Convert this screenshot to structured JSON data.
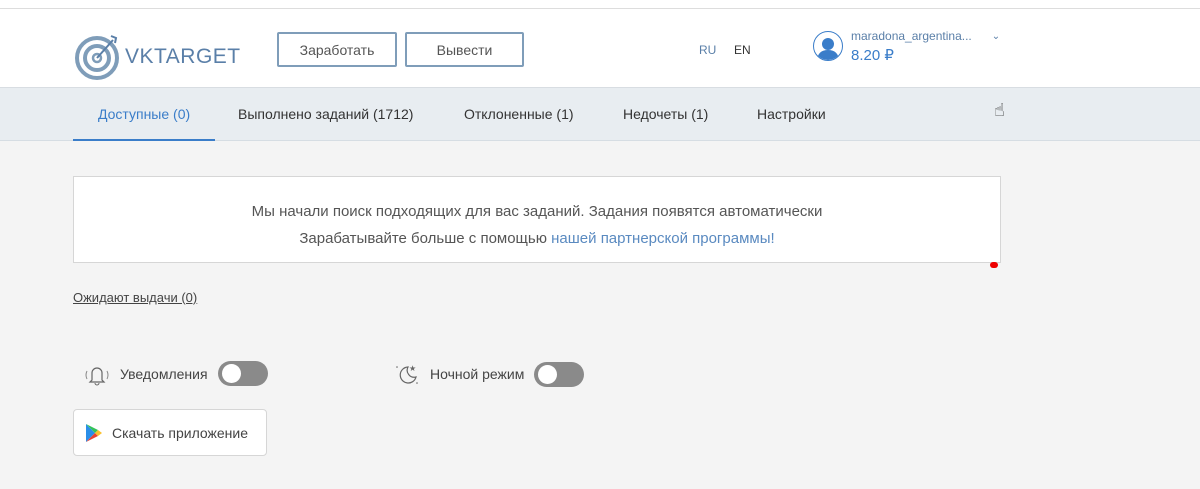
{
  "header": {
    "logo": "VKTARGET",
    "logo_vk": "VK",
    "logo_target": "TARGET",
    "earn_label": "Заработать",
    "withdraw_label": "Вывести",
    "lang_ru": "RU",
    "lang_en": "EN",
    "username": "maradona_argentina...",
    "balance": "8.20 ₽"
  },
  "tabs": [
    {
      "label": "Доступные (0)"
    },
    {
      "label": "Выполнено заданий (1712)"
    },
    {
      "label": "Отклоненные (1)"
    },
    {
      "label": "Недочеты (1)"
    },
    {
      "label": "Настройки"
    }
  ],
  "notice": {
    "line1": "Мы начали поиск подходящих для вас заданий. Задания появятся автоматически",
    "line2_prefix": "Зарабатывайте больше с помощью ",
    "line2_link": "нашей партнерской программы!"
  },
  "awaiting_link": "Ожидают выдачи (0)",
  "settings": {
    "notifications_label": "Уведомления",
    "notifications_on": false,
    "night_mode_label": "Ночной режим",
    "night_mode_on": false
  },
  "download_app_label": "Скачать приложение"
}
